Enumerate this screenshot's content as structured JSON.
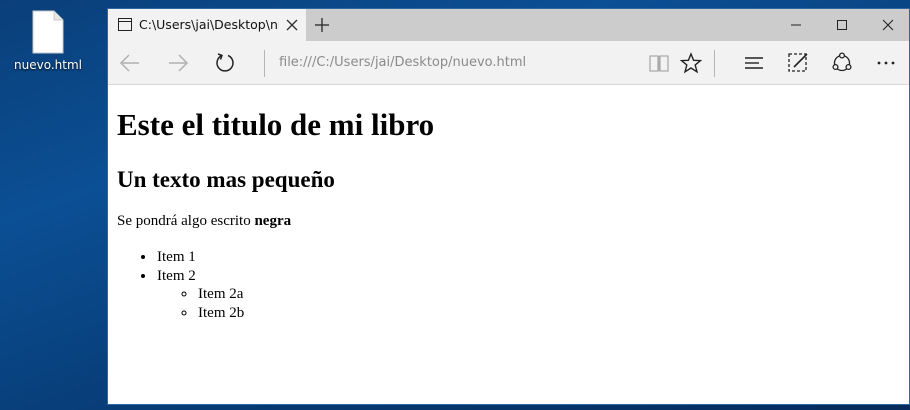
{
  "desktop": {
    "file_icon": "html-file-icon",
    "file_label": "nuevo.html"
  },
  "browser": {
    "tab": {
      "icon": "page-tab-icon",
      "title": "C:\\Users\\jai\\Desktop\\nu"
    },
    "address_bar": {
      "url": "file:///C:/Users/jai/Desktop/nuevo.html"
    },
    "icons": {
      "back": "back-arrow-icon",
      "forward": "forward-arrow-icon",
      "refresh": "refresh-icon",
      "reading_view": "reading-view-icon",
      "favorite": "star-icon",
      "hub": "hub-icon",
      "web_note": "web-note-icon",
      "share": "share-icon",
      "more": "more-icon"
    }
  },
  "page": {
    "h1": "Este el titulo de mi libro",
    "h2": "Un texto mas pequeño",
    "paragraph_text": "Se pondrá algo escrito ",
    "paragraph_bold": "negra",
    "list": [
      "Item 1",
      "Item 2"
    ],
    "sublist": [
      "Item 2a",
      "Item 2b"
    ]
  },
  "colors": {
    "desktop_bg": "#0b4f94",
    "titlebar": "#cccccc",
    "toolbar": "#f2f2f2"
  }
}
